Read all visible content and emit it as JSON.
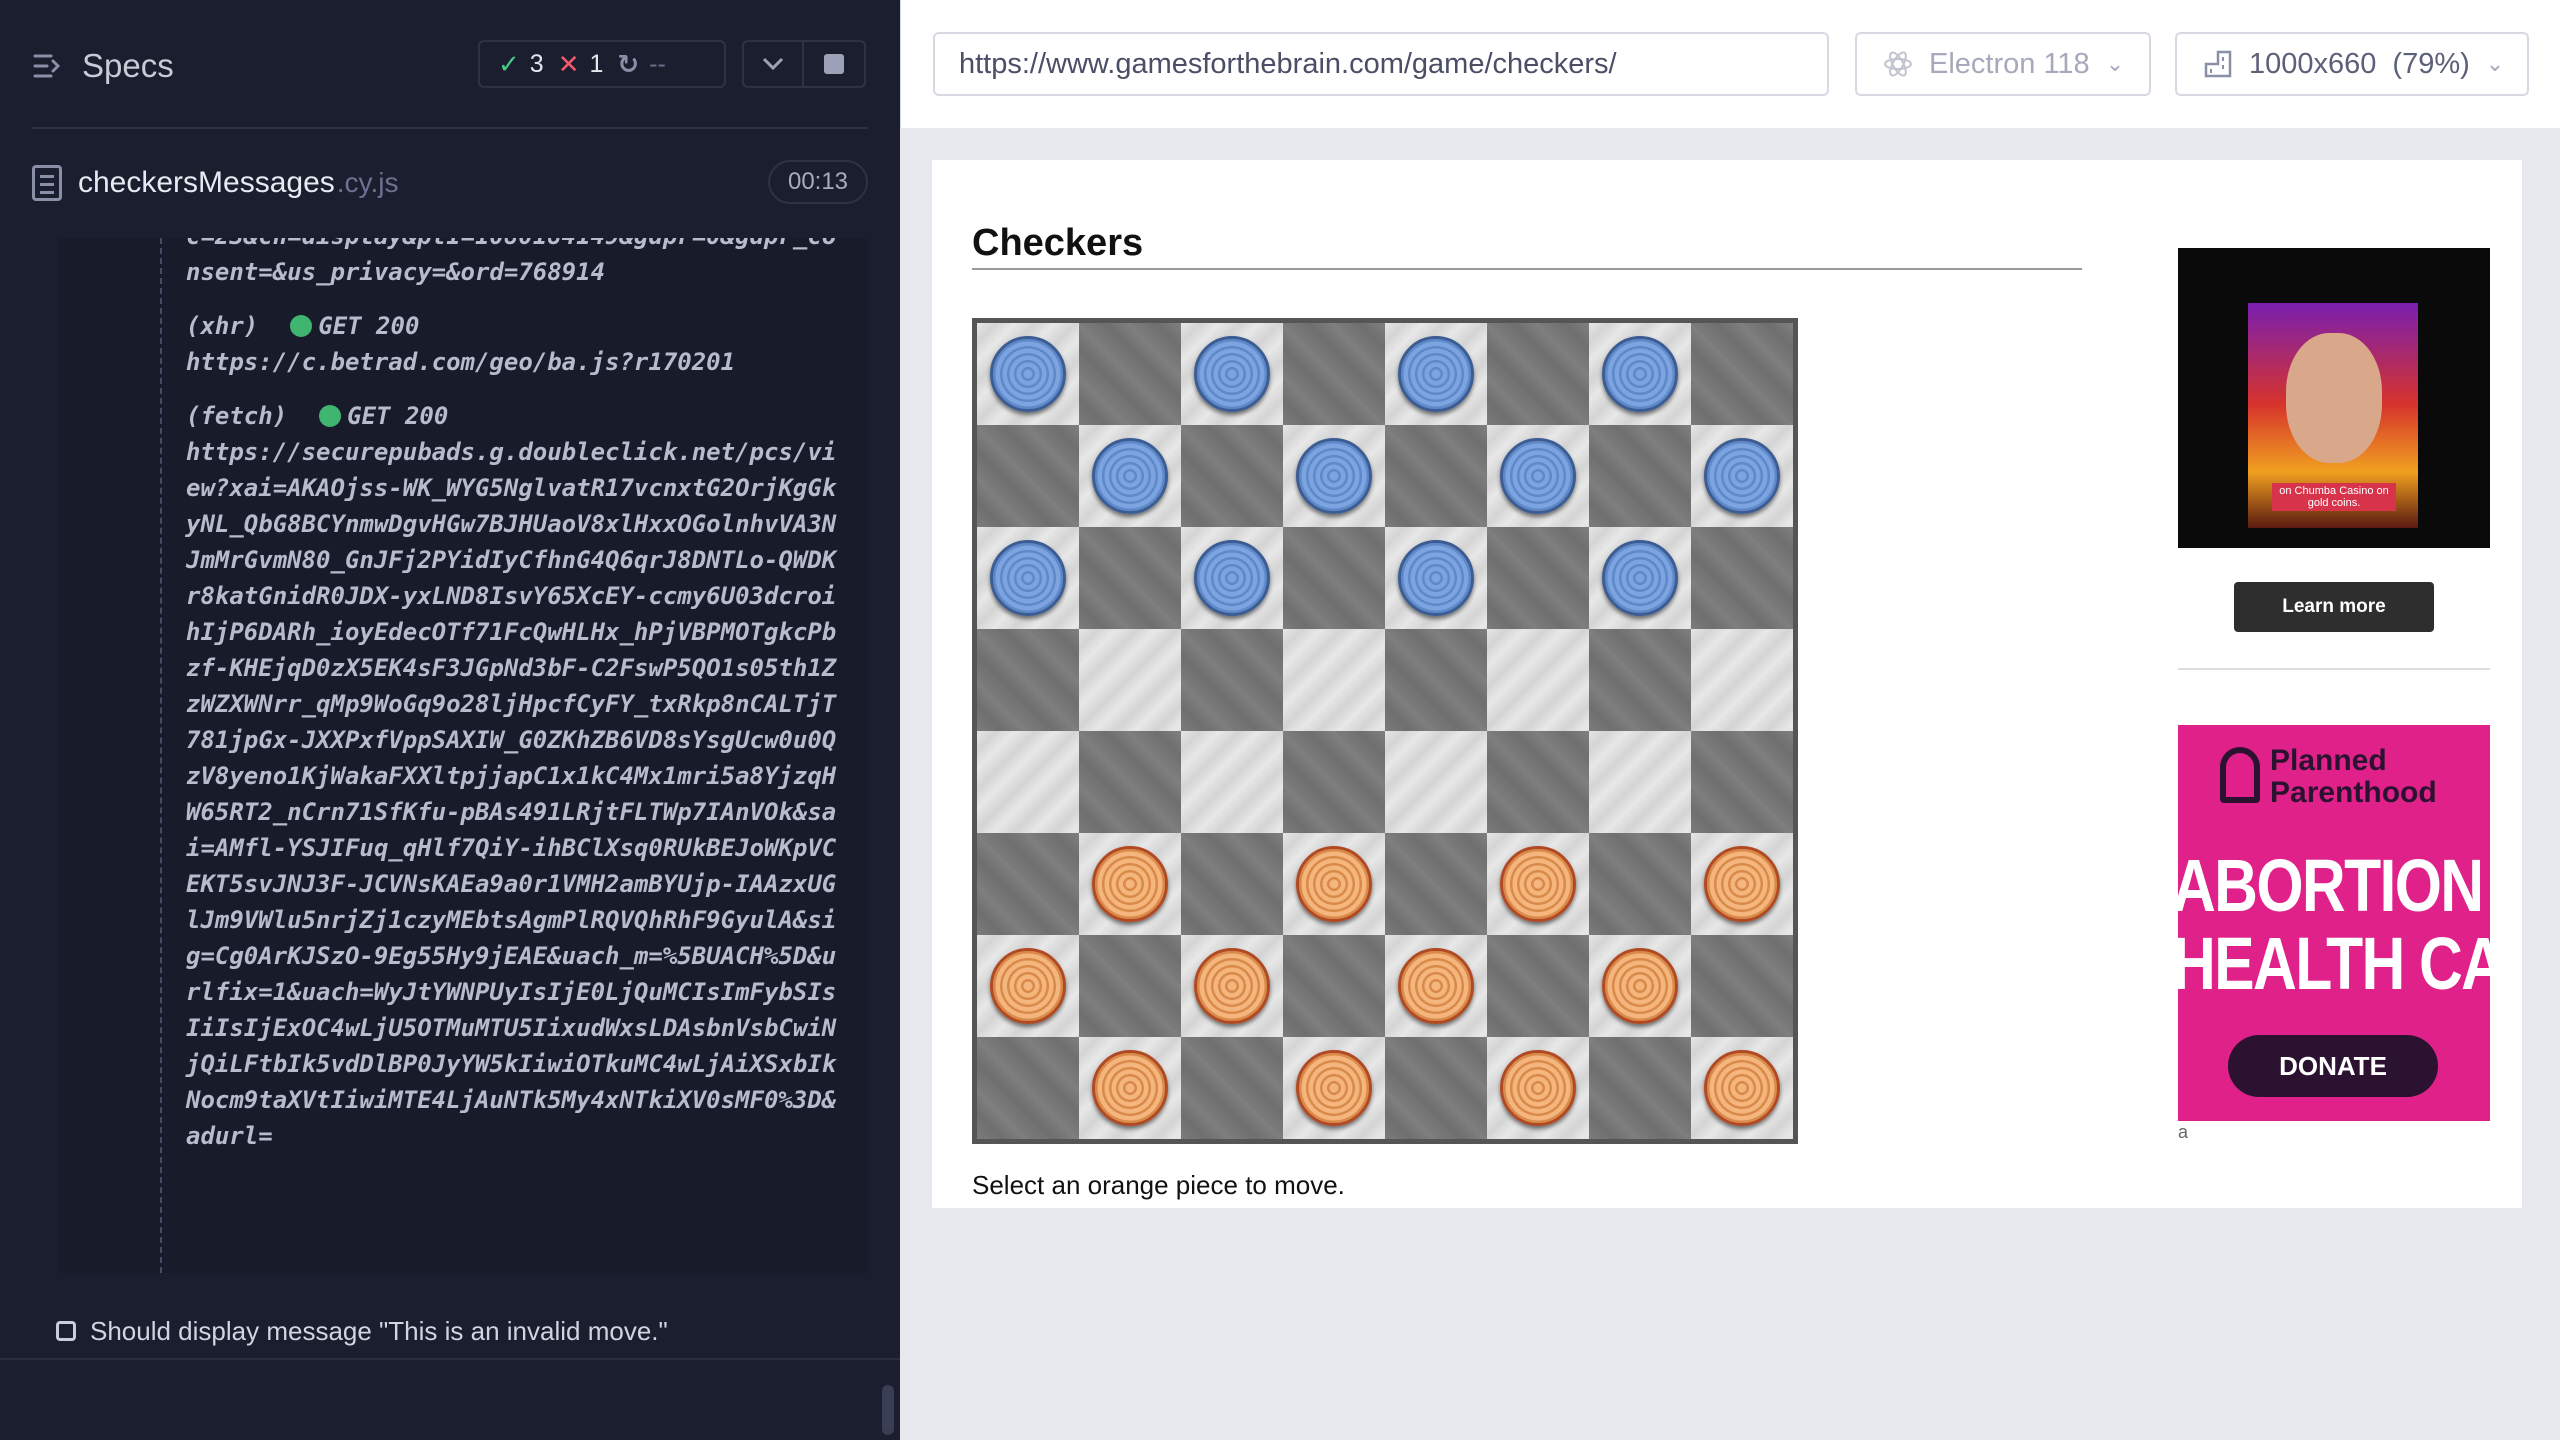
{
  "reporter": {
    "title": "Specs",
    "stats": {
      "passed": "3",
      "failed": "1",
      "pending": "--"
    },
    "file": {
      "name": "checkersMessages",
      "ext": ".cy.js",
      "duration": "00:13"
    },
    "log": [
      {
        "type": "",
        "status": "",
        "url": "c=23&ch=display&pt1=1080184149&gdpr=0&gdpr_consent=&us_privacy=&ord=768914"
      },
      {
        "type": "(xhr)",
        "status": "GET 200",
        "url": "https://c.betrad.com/geo/ba.js?r170201"
      },
      {
        "type": "(fetch)",
        "status": "GET 200",
        "url": "https://securepubads.g.doubleclick.net/pcs/view?xai=AKAOjss-WK_WYG5NglvatR17vcnxtG2OrjKgGkyNL_QbG8BCYnmwDgvHGw7BJHUaoV8xlHxxOGolnhvVA3NJmMrGvmN80_GnJFj2PYidIyCfhnG4Q6qrJ8DNTLo-QWDKr8katGnidR0JDX-yxLND8IsvY65XcEY-ccmy6U03dcroihIjP6DARh_ioyEdecOTf71FcQwHLHx_hPjVBPMOTgkcPbzf-KHEjqD0zX5EK4sF3JGpNd3bF-C2FswP5QO1s05th1ZzWZXWNrr_qMp9WoGq9o28ljHpcfCyFY_txRkp8nCALTjT781jpGx-JXXPxfVppSAXIW_G0ZKhZB6VD8sYsgUcw0u0QzV8yeno1KjWakaFXXltpjjapC1x1kC4Mx1mri5a8YjzqHW65RT2_nCrn71SfKfu-pBAs491LRjtFLTWp7IAnVOk&sai=AMfl-YSJIFuq_qHlf7QiY-ihBClXsq0RUkBEJoWKpVCEKT5svJNJ3F-JCVNsKAEa9a0r1VMH2amBYUjp-IAAzxUGlJm9VWlu5nrjZj1czyMEbtsAgmPlRQVQhRhF9GyulA&sig=Cg0ArKJSzO-9Eg55Hy9jEAE&uach_m=%5BUACH%5D&urlfix=1&uach=WyJtYWNPUyIsIjE0LjQuMCIsImFybSIsIiIsIjExOC4wLjU5OTMuMTU5IixudWxsLDAsbnVsbCwiNjQiLFtbIk5vdDlBP0JyYW5kIiwiOTkuMC4wLjAiXSxbIkNocm9taXVtIiwiMTE4LjAuNTk5My4xNTkiXV0sMF0%3D&adurl="
      }
    ],
    "test_label": "Should display message \"This is an invalid move.\""
  },
  "aut": {
    "url": "https://www.gamesforthebrain.com/game/checkers/",
    "browser": "Electron 118",
    "viewport": "1000x660",
    "zoom": "(79%)"
  },
  "game": {
    "title": "Checkers",
    "message": "Select an orange piece to move.",
    "board": [
      [
        "b",
        "",
        "b",
        "",
        "b",
        "",
        "b",
        ""
      ],
      [
        "",
        "b",
        "",
        "b",
        "",
        "b",
        "",
        "b"
      ],
      [
        "b",
        "",
        "b",
        "",
        "b",
        "",
        "b",
        ""
      ],
      [
        "",
        "",
        "",
        "",
        "",
        "",
        "",
        ""
      ],
      [
        "",
        "",
        "",
        "",
        "",
        "",
        "",
        ""
      ],
      [
        "",
        "o",
        "",
        "o",
        "",
        "o",
        "",
        "o"
      ],
      [
        "o",
        "",
        "o",
        "",
        "o",
        "",
        "o",
        ""
      ],
      [
        "",
        "o",
        "",
        "o",
        "",
        "o",
        "",
        "o"
      ]
    ]
  },
  "ads": {
    "ad1_caption": "on Chumba Casino on gold coins.",
    "learn_more": "Learn more",
    "ad2_brand": "Planned Parenthood",
    "ad2_line1": "ABORTION",
    "ad2_line2": "HEALTH CARE",
    "donate": "DONATE",
    "ad_mark": "a"
  }
}
